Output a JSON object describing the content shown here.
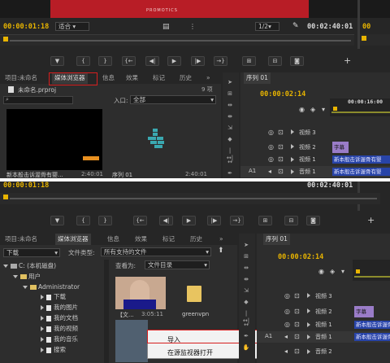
{
  "top": {
    "monitor_watermark": "PROMOTICS",
    "src_timecode": "00:00:01:18",
    "src_fit": "适合",
    "prog_zoom": "1/2",
    "prog_timecode": "00:02:40:01",
    "transport": [
      "▼",
      "{",
      "}",
      "{←",
      "◀|",
      "▶",
      "|▶",
      "→}",
      "",
      "",
      ""
    ],
    "tabs": [
      "项目:未命名",
      "媒体浏览器",
      "信息",
      "效果",
      "标记",
      "历史"
    ],
    "tabs_more": "»",
    "project_name": "未命名.prproj",
    "item_count": "9 项",
    "entry_label": "入口:",
    "entry_value": "全部",
    "thumb1_label": "新本般击诉渥骨有婴...",
    "thumb1_dur": "2:40:01",
    "thumb2_label": "序列 01",
    "thumb2_dur": "2:40:01",
    "seq_tab": "序列 01",
    "seq_timecode": "00:00:02:14",
    "ruler": "00:00:16:00",
    "tracks": [
      {
        "name": "视频 3"
      },
      {
        "name": "视频 2"
      },
      {
        "name": "视频 1"
      },
      {
        "label": "A1",
        "name": "音频 1"
      }
    ],
    "clip_caption": "字幕",
    "clip_video": "新本般击诉渥骨有婴",
    "clip_audio": "新本般击诉渥骨有婴"
  },
  "bottom": {
    "src_timecode": "00:00:01:18",
    "prog_timecode": "00:02:40:01",
    "tabs": [
      "项目:未命名",
      "媒体浏览器",
      "信息",
      "效果",
      "标记",
      "历史"
    ],
    "tabs_more": "»",
    "location": "下载",
    "file_type_label": "文件类型:",
    "file_type_value": "所有支持的文件",
    "view_label": "查看为:",
    "view_value": "文件目录",
    "tree": [
      {
        "text": "C: (本机磁盘)",
        "level": 0,
        "kind": "drive"
      },
      {
        "text": "用户",
        "level": 1,
        "kind": "folder"
      },
      {
        "text": "Administrator",
        "level": 2,
        "kind": "folder"
      },
      {
        "text": "下载",
        "level": 3,
        "kind": "file"
      },
      {
        "text": "我的图片",
        "level": 3,
        "kind": "file"
      },
      {
        "text": "我的文档",
        "level": 3,
        "kind": "file"
      },
      {
        "text": "我的视频",
        "level": 3,
        "kind": "file"
      },
      {
        "text": "我的音乐",
        "level": 3,
        "kind": "file"
      },
      {
        "text": "搜索",
        "level": 3,
        "kind": "file"
      }
    ],
    "thumb_video_label": "【文...",
    "thumb_video_dur": "3:05:11",
    "thumb_folder_label": "greenvpn",
    "context_menu": [
      "导入",
      "在源监视器打开"
    ],
    "seq_tab": "序列 01",
    "seq_timecode": "00:00:02:14",
    "tracks": [
      {
        "name": "视频 3"
      },
      {
        "name": "视频 2"
      },
      {
        "name": "视频 1"
      },
      {
        "label": "A1",
        "name": "音频 1"
      },
      {
        "name": "音频 2"
      }
    ],
    "clip_caption": "字幕",
    "clip_video": "新本般击诉渥骨",
    "clip_audio": "新本般击诉渥骨"
  }
}
